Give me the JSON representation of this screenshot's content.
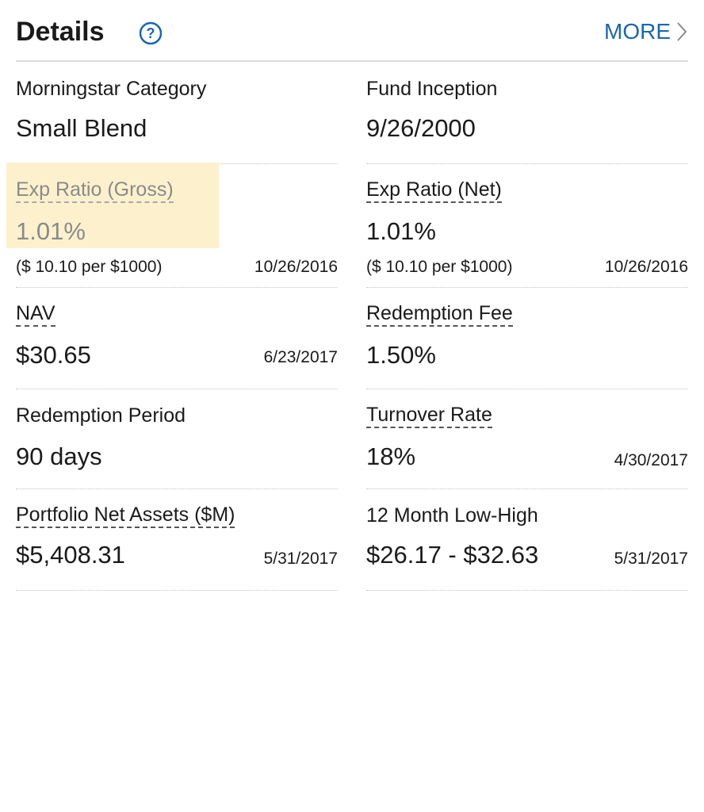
{
  "header": {
    "title": "Details",
    "help_icon": "question-circle-icon",
    "more_label": "MORE",
    "more_icon": "chevron-right-icon"
  },
  "colors": {
    "link": "#1a66b3",
    "highlight": "#fdf1cd",
    "text": "#1a1a1a",
    "muted": "#8a8a8a"
  },
  "details": {
    "category": {
      "label": "Morningstar Category",
      "value": "Small Blend"
    },
    "inception": {
      "label": "Fund Inception",
      "value": "9/26/2000"
    },
    "exp_gross": {
      "label": "Exp Ratio (Gross)",
      "value": "1.01%",
      "note": "($ 10.10 per $1000)",
      "date": "10/26/2016"
    },
    "exp_net": {
      "label": "Exp Ratio (Net)",
      "value": "1.01%",
      "note": "($ 10.10 per $1000)",
      "date": "10/26/2016"
    },
    "nav": {
      "label": "NAV",
      "value": "$30.65",
      "date": "6/23/2017"
    },
    "redemption_fee": {
      "label": "Redemption Fee",
      "value": "1.50%"
    },
    "redemption_period": {
      "label": "Redemption Period",
      "value": "90 days"
    },
    "turnover": {
      "label": "Turnover Rate",
      "value": "18%",
      "date": "4/30/2017"
    },
    "net_assets": {
      "label": "Portfolio Net Assets ($M)",
      "value": "$5,408.31",
      "date": "5/31/2017"
    },
    "low_high": {
      "label": "12 Month Low-High",
      "value": "$26.17 - $32.63",
      "date": "5/31/2017"
    }
  }
}
